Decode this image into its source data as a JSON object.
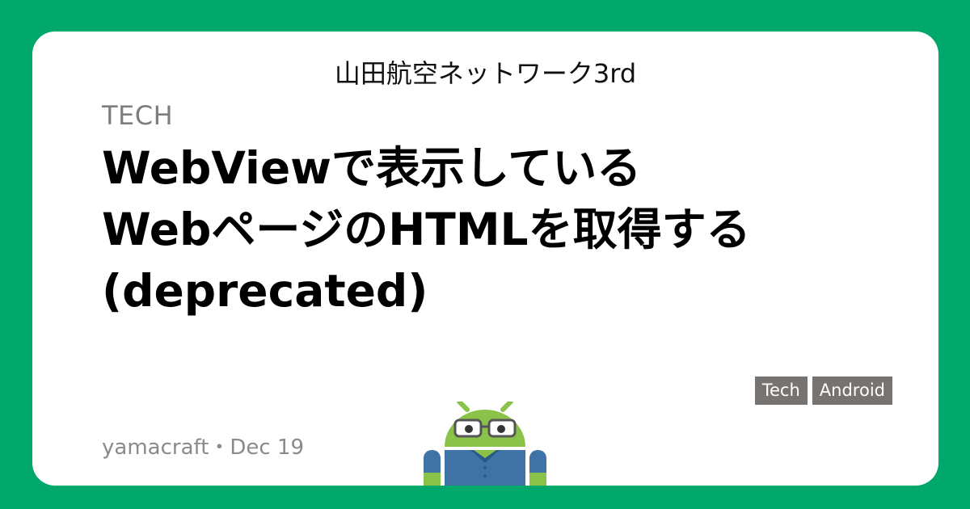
{
  "colors": {
    "background": "#00a96b",
    "card": "#ffffff",
    "tag_background": "#777370",
    "mascot_green": "#8bc34a",
    "mascot_shirt": "#3f73a6"
  },
  "site": {
    "title": "山田航空ネットワーク3rd"
  },
  "post": {
    "category": "TECH",
    "title_lines": [
      "WebViewで表示している",
      "WebページのHTMLを取得する",
      "(deprecated)"
    ],
    "tags": [
      "Tech",
      "Android"
    ],
    "author": "yamacraft",
    "separator": "・",
    "date": "Dec 19"
  },
  "mascot": {
    "icon": "android-robot-with-glasses"
  }
}
